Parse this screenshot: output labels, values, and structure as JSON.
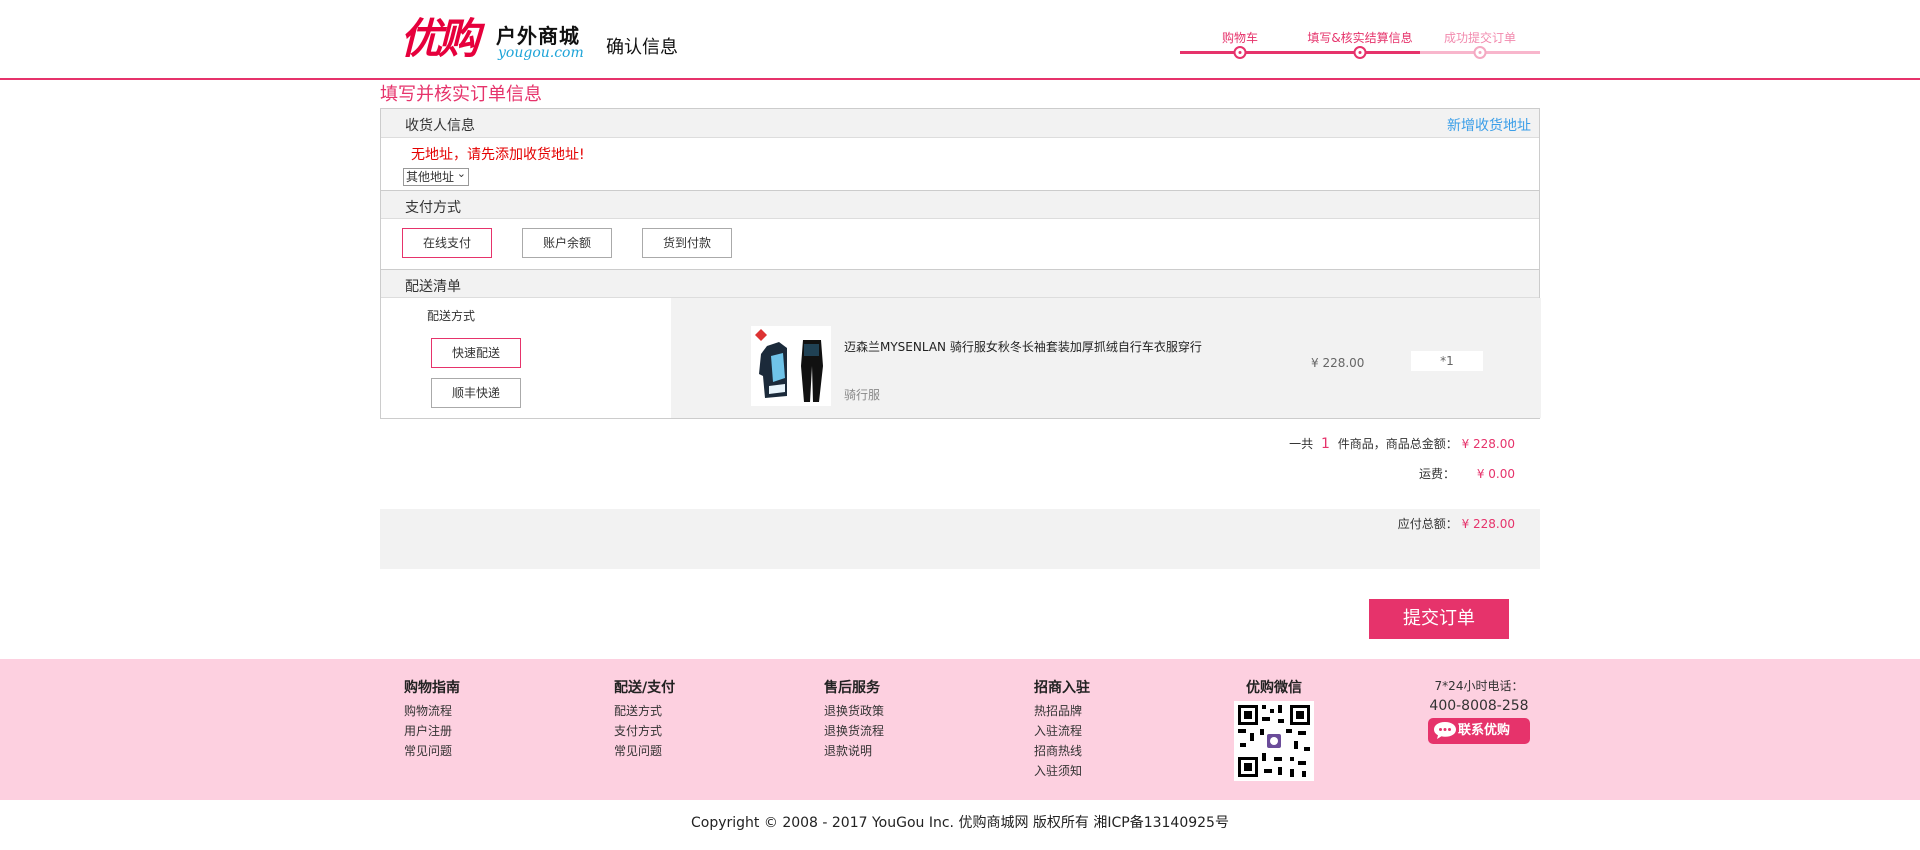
{
  "header": {
    "logo_main": "优购",
    "logo_cn": "户外商城",
    "logo_en": "yougou.com",
    "title": "确认信息",
    "steps": [
      {
        "label": "购物车",
        "state": "done"
      },
      {
        "label": "填写&核实结算信息",
        "state": "current"
      },
      {
        "label": "成功提交订单",
        "state": "todo"
      }
    ]
  },
  "section_title": "填写并核实订单信息",
  "consignee": {
    "title": "收货人信息",
    "add_link": "新增收货地址",
    "warning": "无地址，请先添加收货地址!",
    "select_value": "其他地址"
  },
  "payment": {
    "title": "支付方式",
    "options": [
      "在线支付",
      "账户余额",
      "货到付款"
    ],
    "selected": "在线支付"
  },
  "shipping": {
    "title": "配送清单",
    "method_label": "配送方式",
    "methods": [
      "快速配送",
      "顺丰快递"
    ],
    "selected": "快速配送",
    "product": {
      "name": "迈森兰MYSENLAN 骑行服女秋冬长袖套装加厚抓绒自行车衣服穿行",
      "category": "骑行服",
      "price": "¥ 228.00",
      "qty": "*1"
    }
  },
  "summary": {
    "count_prefix": "一共",
    "count": "1",
    "count_suffix": "件商品，商品总金额：",
    "goods_total": "¥  228.00",
    "freight_label": "运费：",
    "freight": "¥  0.00",
    "payable_label": "应付总额：",
    "payable": "¥  228.00"
  },
  "submit_label": "提交订单",
  "footer": {
    "columns": [
      {
        "title": "购物指南",
        "items": [
          "购物流程",
          "用户注册",
          "常见问题"
        ]
      },
      {
        "title": "配送/支付",
        "items": [
          "配送方式",
          "支付方式",
          "常见问题"
        ]
      },
      {
        "title": "售后服务",
        "items": [
          "退换货政策",
          "退换货流程",
          "退款说明"
        ]
      },
      {
        "title": "招商入驻",
        "items": [
          "热招品牌",
          "入驻流程",
          "招商热线",
          "入驻须知"
        ]
      }
    ],
    "wechat_title": "优购微信",
    "tel_label": "7*24小时电话：",
    "tel": "400-8008-258",
    "contact_label": "联系优购"
  },
  "copyright": "Copyright © 2008 - 2017 YouGou Inc. 优购商城网  版权所有     湘ICP备13140925号",
  "colors": {
    "accent": "#e6336b",
    "warning": "#e40000",
    "link": "#3a9ee8",
    "footer_bg": "#fdd0e0"
  }
}
